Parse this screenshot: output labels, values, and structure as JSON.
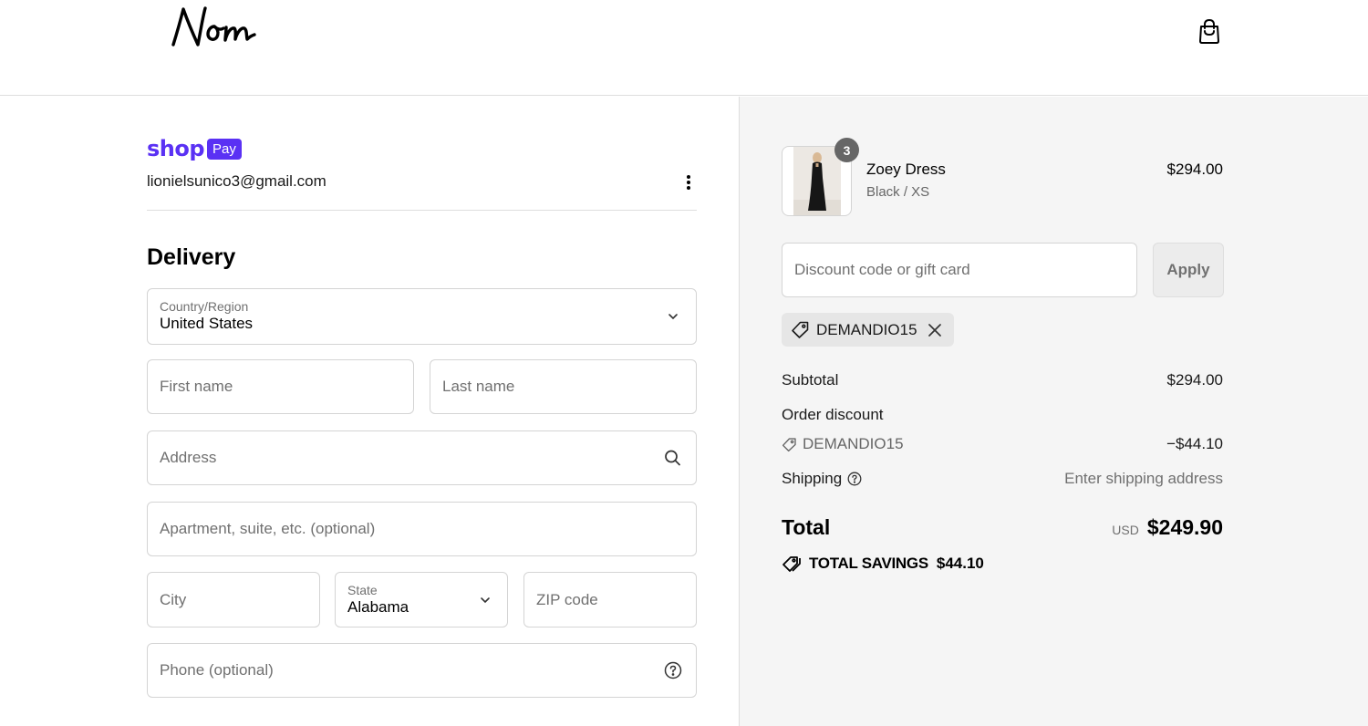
{
  "header": {
    "brand": "Nom",
    "cart_icon": "shopping-bag-icon"
  },
  "account": {
    "shop_word": "shop",
    "pay_word": "Pay",
    "email": "lionielsunico3@gmail.com",
    "menu_icon": "more-vertical-icon"
  },
  "delivery": {
    "title": "Delivery",
    "country_label": "Country/Region",
    "country_value": "United States",
    "first_name_placeholder": "First name",
    "last_name_placeholder": "Last name",
    "address_placeholder": "Address",
    "apartment_placeholder": "Apartment, suite, etc. (optional)",
    "city_placeholder": "City",
    "state_label": "State",
    "state_value": "Alabama",
    "zip_placeholder": "ZIP code",
    "phone_placeholder": "Phone (optional)"
  },
  "summary": {
    "item": {
      "quantity": "3",
      "name": "Zoey Dress",
      "variant": "Black / XS",
      "price": "$294.00"
    },
    "discount_placeholder": "Discount code or gift card",
    "apply_label": "Apply",
    "applied_code": "DEMANDIO15",
    "subtotal_label": "Subtotal",
    "subtotal_value": "$294.00",
    "order_discount_label": "Order discount",
    "discount_code": "DEMANDIO15",
    "discount_value": "−$44.10",
    "shipping_label": "Shipping",
    "shipping_value": "Enter shipping address",
    "total_label": "Total",
    "currency": "USD",
    "total_value": "$249.90",
    "savings_label": "TOTAL SAVINGS",
    "savings_value": "$44.10"
  },
  "colors": {
    "shop_pay_purple": "#5a31f4",
    "summary_bg": "#f5f5f5",
    "border": "#d4d4d4"
  }
}
